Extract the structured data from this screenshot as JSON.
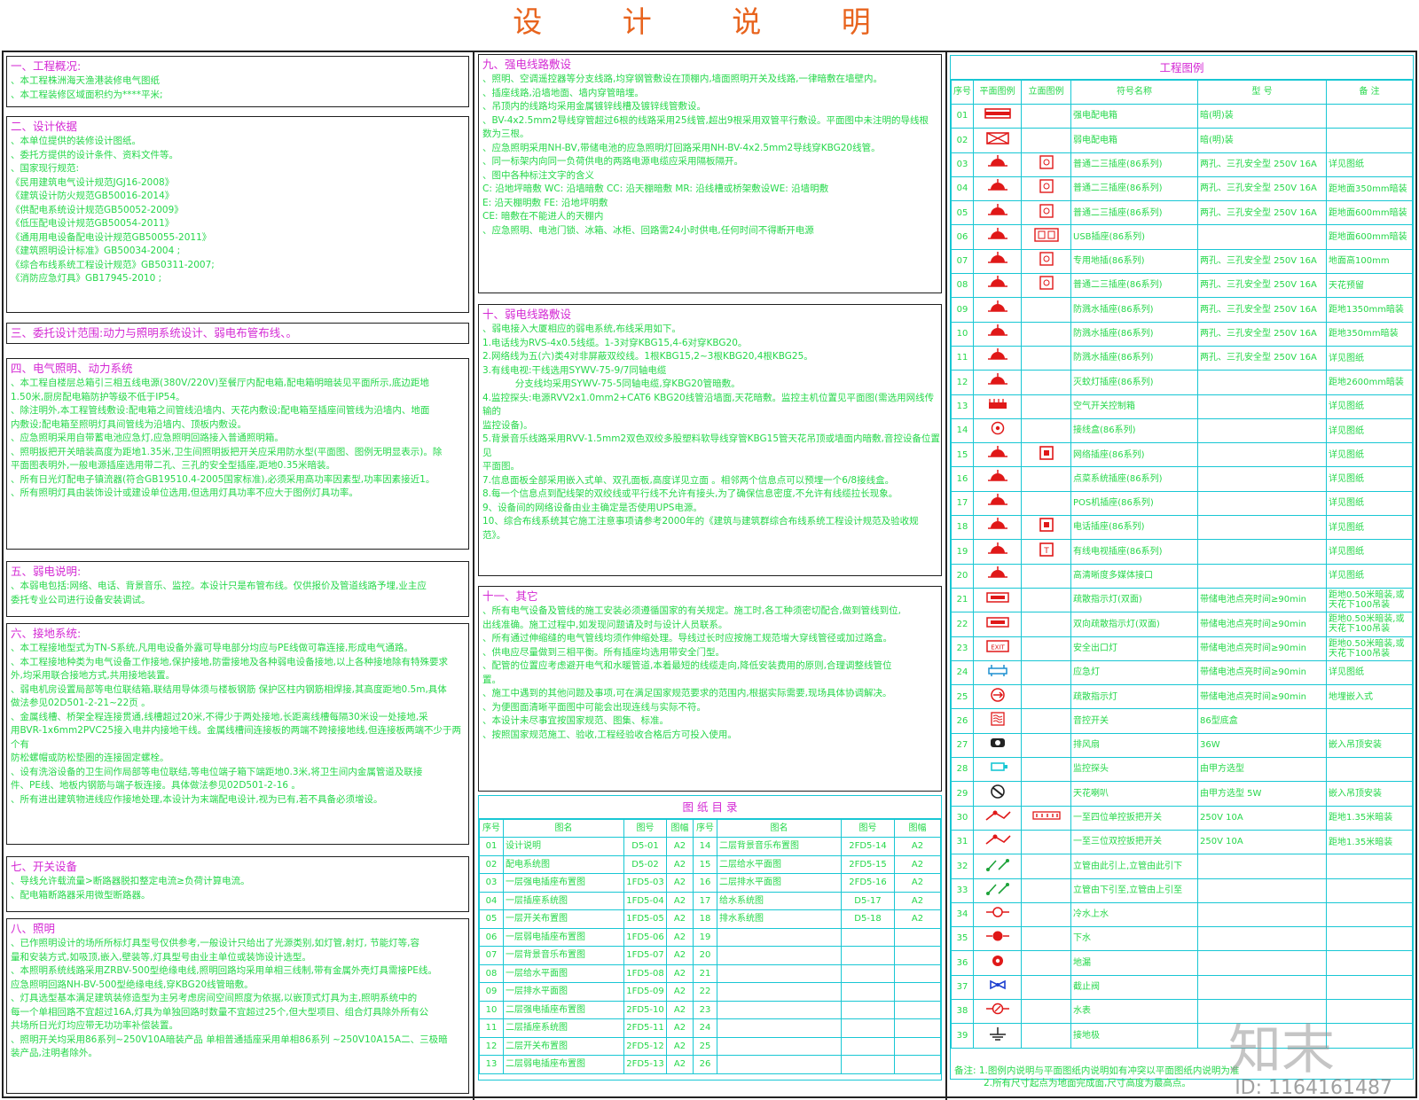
{
  "title": "设 计 说 明",
  "left": {
    "s1": {
      "title": "一、工程概况:",
      "lines": [
        "、本工程株洲海天渔港装修电气图纸",
        "、本工程装修区域面积约为****平米;"
      ]
    },
    "s2": {
      "title": "二、设计依据",
      "lines": [
        "、本单位提供的装修设计图纸。",
        "、委托方提供的设计条件、资料文件等。",
        "、国家现行规范:",
        "《民用建筑电气设计规范JGJ16-2008》",
        "《建筑设计防火规范GB50016-2014》",
        "《供配电系统设计规范GB50052-2009》",
        "《低压配电设计规范GB50054-2011》",
        "《通用用电设备配电设计规范GB50055-2011》",
        "《建筑照明设计标准》GB50034-2004 ;",
        "《综合布线系统工程设计规范》GB50311-2007;",
        "《消防应急灯具》GB17945-2010 ;"
      ]
    },
    "s3": {
      "title": "三、委托设计范围:动力与照明系统设计、弱电布管布线、。",
      "lines": []
    },
    "s4": {
      "title": "四、电气照明、动力系统",
      "lines": [
        "、本工程自楼层总箱引三相五线电源(380V/220V)至餐厅内配电箱,配电箱明暗装见平面所示,底边距地",
        "1.50米,厨房配电箱防护等级不低于IP54。",
        "、除注明外,本工程管线敷设:配电箱之间管线沿墙内、天花内敷设;配电箱至插座间管线为沿墙内、地面",
        "内敷设;配电箱至照明灯具间管线为沿墙内、顶板内敷设。",
        "、应急照明采用自带蓄电池应急灯,应急照明回路接入普通照明箱。",
        "、照明扳把开关暗装高度为距地1.35米,卫生间照明扳把开关应采用防水型(平面图、图例无明显表示)。除",
        "平面图表明外,一般电源插座选用带二孔、三孔的安全型插座,距地0.35米暗装。",
        "、所有日光灯配电子镇流器(符合GB19510.4-2005国家标准),必须采用高功率因素型,功率因素接近1。",
        "、所有照明灯具由装饰设计或建设单位选用,但选用灯具功率不应大于图例灯具功率。"
      ]
    },
    "s5": {
      "title": "五、弱电说明:",
      "lines": [
        "、本弱电包括:网络、电话、背景音乐、监控。本设计只是布管布线。仅供报价及管道线路予埋,业主应",
        "委托专业公司进行设备安装调试。"
      ]
    },
    "s6": {
      "title": "六、接地系统:",
      "lines": [
        "、本工程接地型式为TN-S系统,凡用电设备外露可导电部分均应与PE线做可靠连接,形成电气通路。",
        "、本工程接地种类为电气设备工作接地,保护接地,防雷接地及各种弱电设备接地,以上各种接地除有特殊要求",
        "外,均采用联合接地方式,共用接地装置。",
        "、弱电机房设置局部等电位联结箱,联结用导体须与楼板钢筋 保护区柱内钢筋相焊接,其高度距地0.5m,具体",
        "做法参见02D501-2-21~22页 。",
        "、金属线槽、桥架全程连接贯通,线槽超过20米,不得少于两处接地,长距离线槽每隔30米设一处接地,采",
        "用BVR-1x6mm2PVC25接入电井内接地干线。金属线槽间连接板的两端不跨接接地线,但连接板两端不少于两个有",
        "防松螺帽或防松垫圈的连接固定螺栓。",
        "、设有洗浴设备的卫生间作局部等电位联结,等电位端子箱下端距地0.3米,将卫生间内金属管道及联接",
        "件、PE线、地板内钢筋与端子板连接。具体做法参见02D501-2-16 。",
        "、所有进出建筑物进线应作接地处理,本设计为末端配电设计,视为已有,若不具备必须增设。"
      ]
    },
    "s7": {
      "title": "七、开关设备",
      "lines": [
        "、导线允许载流量>断路器脱扣整定电流≥负荷计算电流。",
        "、配电箱断路器采用微型断路器。"
      ]
    },
    "s8": {
      "title": "八、照明",
      "lines": [
        "、已作照明设计的场所所标灯具型号仅供参考,一般设计只给出了光源类别,如灯管,射灯, 节能灯等,容",
        "量和安装方式,如吸顶,嵌入,壁装等,灯具型号由业主单位或装饰设计选型。",
        "、本照明系统线路采用ZRBV-500型绝缘电线,照明回路均采用单相三线制,带有金属外壳灯具需接PE线。",
        "应急照明回路NH-BV-500型绝缘电线,穿KBG20线管暗敷。",
        "、灯具选型基本满足建筑装修造型为主另考虑房间空间照度为依据,以嵌顶式灯具为主,照明系统中的",
        "每一个单相回路不宜超过16A,灯具为单独回路时数量不宜超过25个,但大型项目、组合灯具除外所有公",
        "共场所日光灯均应带无功功率补偿装置。",
        "、照明开关均采用86系列~250V10A暗装产品 单相普通插座采用单相86系列 ~250V10A15A二、三极暗",
        "装产品,注明者除外。"
      ]
    }
  },
  "middle": {
    "s9": {
      "title": "九、强电线路敷设",
      "lines": [
        "、照明、空调遥控器等分支线路,均穿钢管敷设在顶棚内,墙面照明开关及线路,一律暗敷在墙壁内。",
        "、插座线路,沿墙地面、墙内穿管暗埋。",
        "、吊顶内的线路均采用金属镀锌线槽及镀锌线管敷设。",
        "、BV-4x2.5mm2导线穿管超过6根的线路采用25线管,超出9根采用双管平行敷设。平面图中未注明的导线根",
        "数为三根。",
        "、应急照明采用NH-BV,带储电池的应急照明灯回路采用NH-BV-4x2.5mm2导线穿KBG20线管。",
        "、同一标架内向同一负荷供电的两路电源电缆应采用隔板隔开。",
        "、图中各种标注文字的含义",
        "C: 沿地坪暗敷 WC: 沿墙暗敷 CC: 沿天棚暗敷 MR: 沿线槽或桥架敷设WE: 沿墙明敷",
        "E: 沿天棚明敷 FE: 沿地坪明敷",
        "CE: 暗敷在不能进人的天棚内",
        "、应急照明、电池门锁、冰箱、冰柜、回路需24小时供电,任何时间不得断开电源"
      ]
    },
    "s10": {
      "title": "十、弱电线路敷设",
      "lines": [
        "、弱电接入大厦相应的弱电系统,布线采用如下。",
        "1.电话线为RVS-4x0.5线缆。1-3对穿KBG15,4-6对穿KBG20。",
        "2.网络线为五(六)类4对非屏蔽双绞线。1根KBG15,2~3根KBG20,4根KBG25。",
        "3.有线电视:干线选用SYWV-75-9/7同轴电缆",
        "           分支线均采用SYWV-75-5同轴电缆,穿KBG20管暗敷。",
        "4.监控探头:电源RVV2x1.0mm2+CAT6 KBG20线管沿墙面,天花暗敷。监控主机位置见平面图(需选用网线传输的",
        "监控设备)。",
        "5.背景音乐线路采用RVV-1.5mm2双色双绞多股塑料软导线穿管KBG15管天花吊顶或墙面内暗敷,音控设备位置见",
        "平面图。",
        "7.信息面板全部采用嵌入式单、双孔面板,高度详见立面 。相邻两个信息点可以预埋一个6/8接线盒。",
        "8.每一个信息点到配线架的双绞线或平行线不允许有接头,为了确保信息密度,不允许有线缆拉长现象。",
        "9、设备间的网络设备由业主确定是否使用UPS电源。",
        "10、综合布线系统其它施工注意事项请参考2000年的《建筑与建筑群综合布线系统工程设计规范及验收规",
        "范》。"
      ]
    },
    "s11": {
      "title": "十一、其它",
      "lines": [
        "、所有电气设备及管线的施工安装必须遵循国家的有关规定。施工时,各工种须密切配合,做到管线到位,",
        "出线准确。施工过程中,如发现问题请及时与设计人员联系。",
        "、所有通过伸缩缝的电气管线均须作伸缩处理。导线过长时应按施工规范增大穿线管径或加过路盒。",
        "、供电应尽量做到三相平衡。所有插座均选用带安全门型。",
        "、配管的位置应考虑避开电气和水暖管道,本着最短的线缆走向,降低安装费用的原则,合理调整线管位",
        "置。",
        "、施工中遇到的其他问题及事项,可在满足国家规范要求的范围内,根据实际需要,现场具体协调解决。",
        "、为便图面清晰平面图中可能会出现连线与实际不符。",
        "、本设计未尽事宜按国家规范、图集、标准。",
        "、按照国家规范施工、验收,工程经验收合格后方可投入使用。"
      ]
    },
    "catalog": {
      "caption": "图 纸 目 录",
      "headers": [
        "序号",
        "图名",
        "图号",
        "图幅",
        "序号",
        "图名",
        "图号",
        "图幅"
      ],
      "rows": [
        [
          "01",
          "设计说明",
          "D5-01",
          "A2",
          "14",
          "二层背景音乐布置图",
          "2FD5-14",
          "A2"
        ],
        [
          "02",
          "配电系统图",
          "D5-02",
          "A2",
          "15",
          "二层给水平面图",
          "2FD5-15",
          "A2"
        ],
        [
          "03",
          "一层强电插座布置图",
          "1FD5-03",
          "A2",
          "16",
          "二层排水平面图",
          "2FD5-16",
          "A2"
        ],
        [
          "04",
          "一层插座系统图",
          "1FD5-04",
          "A2",
          "17",
          "给水系统图",
          "D5-17",
          "A2"
        ],
        [
          "05",
          "一层开关布置图",
          "1FD5-05",
          "A2",
          "18",
          "排水系统图",
          "D5-18",
          "A2"
        ],
        [
          "06",
          "一层弱电插座布置图",
          "1FD5-06",
          "A2",
          "19",
          "",
          "",
          ""
        ],
        [
          "07",
          "一层背景音乐布置图",
          "1FD5-07",
          "A2",
          "20",
          "",
          "",
          ""
        ],
        [
          "08",
          "一层给水平面图",
          "1FD5-08",
          "A2",
          "21",
          "",
          "",
          ""
        ],
        [
          "09",
          "一层排水平面图",
          "1FD5-09",
          "A2",
          "22",
          "",
          "",
          ""
        ],
        [
          "10",
          "二层强电插座布置图",
          "2FD5-10",
          "A2",
          "23",
          "",
          "",
          ""
        ],
        [
          "11",
          "二层插座系统图",
          "2FD5-11",
          "A2",
          "24",
          "",
          "",
          ""
        ],
        [
          "12",
          "二层开关布置图",
          "2FD5-12",
          "A2",
          "25",
          "",
          "",
          ""
        ],
        [
          "13",
          "二层弱电插座布置图",
          "2FD5-13",
          "A2",
          "26",
          "",
          "",
          ""
        ]
      ]
    }
  },
  "legend": {
    "caption": "工程图例",
    "headers": [
      "序号",
      "平面图例",
      "立面图例",
      "符号名称",
      "型 号",
      "备 注"
    ],
    "rows": [
      [
        "01",
        "配电箱",
        "",
        "强电配电箱",
        "暗(明)装",
        ""
      ],
      [
        "02",
        "弱电箱",
        "",
        "弱电配电箱",
        "暗(明)装",
        ""
      ],
      [
        "03",
        "插座",
        "插座面板",
        "普通二三插座(86系列)",
        "两孔、三孔安全型 250V 16A",
        "详见图纸"
      ],
      [
        "04",
        "插座",
        "插座面板",
        "普通二三插座(86系列)",
        "两孔、三孔安全型 250V 16A",
        "距地面350mm暗装"
      ],
      [
        "05",
        "插座",
        "插座面板",
        "普通二三插座(86系列)",
        "两孔、三孔安全型 250V 16A",
        "距地面600mm暗装"
      ],
      [
        "06",
        "USB插座",
        "USB面板",
        "USB插座(86系列)",
        "",
        "距地面600mm暗装"
      ],
      [
        "07",
        "地插",
        "插座面板",
        "专用地插(86系列)",
        "两孔、三孔安全型 250V 16A",
        "地面高100mm"
      ],
      [
        "08",
        "插座",
        "插座面板",
        "普通二三插座(86系列)",
        "两孔、三孔安全型 250V 16A",
        "天花预留"
      ],
      [
        "09",
        "防水插座",
        "",
        "防溅水插座(86系列)",
        "两孔、三孔安全型 250V 16A",
        "距地1350mm暗装"
      ],
      [
        "10",
        "防水插座",
        "",
        "防溅水插座(86系列)",
        "两孔、三孔安全型 250V 16A",
        "距地350mm暗装"
      ],
      [
        "11",
        "防水插座",
        "",
        "防溅水插座(86系列)",
        "两孔、三孔安全型 250V 16A",
        "详见图纸"
      ],
      [
        "12",
        "插座",
        "",
        "灭蚊灯插座(86系列)",
        "",
        "距地2600mm暗装"
      ],
      [
        "13",
        "空开",
        "",
        "空气开关控制箱",
        "",
        "详见图纸"
      ],
      [
        "14",
        "接线盒",
        "",
        "接线盒(86系列)",
        "",
        "详见图纸"
      ],
      [
        "15",
        "网络插座",
        "信息面板",
        "网络插座(86系列)",
        "",
        "详见图纸"
      ],
      [
        "16",
        "插座",
        "",
        "点菜系统插座(86系列)",
        "",
        "详见图纸"
      ],
      [
        "17",
        "插座",
        "",
        "POS机插座(86系列)",
        "",
        "详见图纸"
      ],
      [
        "18",
        "电话插座",
        "信息面板",
        "电话插座(86系列)",
        "",
        "详见图纸"
      ],
      [
        "19",
        "电视插座",
        "电视面板",
        "有线电视插座(86系列)",
        "",
        "详见图纸"
      ],
      [
        "20",
        "高清插座",
        "",
        "高清晰度多媒体接口",
        "",
        "详见图纸"
      ],
      [
        "21",
        "疏散灯",
        "",
        "疏散指示灯(双面)",
        "带储电池点亮时间≥90min",
        "距地0.50米暗装,或天花下100吊装"
      ],
      [
        "22",
        "疏散灯",
        "",
        "双向疏散指示灯(双面)",
        "带储电池点亮时间≥90min",
        "距地0.50米暗装,或天花下100吊装"
      ],
      [
        "23",
        "EXIT",
        "",
        "安全出口灯",
        "带储电池点亮时间≥90min",
        "距地0.50米暗装,或天花下100吊装"
      ],
      [
        "24",
        "应急灯",
        "",
        "应急灯",
        "带储电池点亮时间≥90min",
        "详见图纸"
      ],
      [
        "25",
        "地埋灯",
        "",
        "疏散指示灯",
        "带储电池点亮时间≥90min",
        "地埋嵌入式"
      ],
      [
        "26",
        "音控",
        "",
        "音控开关",
        "86型底盒",
        ""
      ],
      [
        "27",
        "排风扇",
        "",
        "排风扇",
        "36W",
        "嵌入吊顶安装"
      ],
      [
        "28",
        "探头",
        "",
        "监控探头",
        "由甲方选型",
        ""
      ],
      [
        "29",
        "喇叭",
        "",
        "天花喇叭",
        "由甲方选型 5W",
        "嵌入吊顶安装"
      ],
      [
        "30",
        "单控开关",
        "开关面板",
        "一至四位单控扳把开关",
        "250V 10A",
        "距地1.35米暗装"
      ],
      [
        "31",
        "双控开关",
        "",
        "一至三位双控扳把开关",
        "250V 10A",
        "距地1.35米暗装"
      ],
      [
        "32",
        "立管上",
        "",
        "立管由此引上,立管由此引下",
        "",
        ""
      ],
      [
        "33",
        "立管下",
        "",
        "立管由下引至,立管由上引至",
        "",
        ""
      ],
      [
        "34",
        "冷水",
        "",
        "冷水上水",
        "",
        ""
      ],
      [
        "35",
        "下水",
        "",
        "下水",
        "",
        ""
      ],
      [
        "36",
        "地漏",
        "",
        "地漏",
        "",
        ""
      ],
      [
        "37",
        "截止阀",
        "",
        "截止阀",
        "",
        ""
      ],
      [
        "38",
        "水表",
        "",
        "水表",
        "",
        ""
      ],
      [
        "39",
        "接地",
        "",
        "接地极",
        "",
        ""
      ]
    ],
    "note1": "备注: 1.图例内说明与平面图纸内说明如有冲突以平面图纸内说明为准",
    "note2": "2.所有尺寸起点为地面完成面,尺寸高度为最高点。"
  },
  "watermark": {
    "brand": "知末",
    "id": "ID: 1164161487"
  },
  "colors": {
    "title": "#e8641e",
    "heading": "#d42ad4",
    "text": "#24d84a",
    "grid": "#18c7d4",
    "symbol": "#e01818"
  }
}
